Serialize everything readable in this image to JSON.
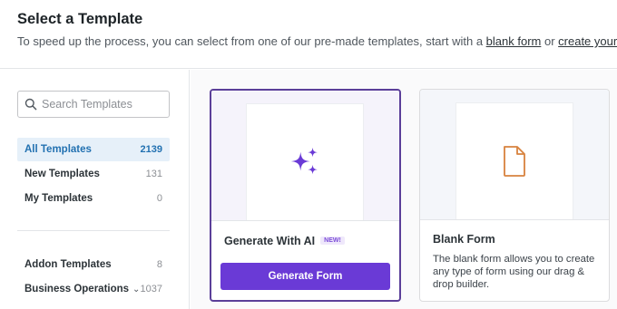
{
  "header": {
    "title": "Select a Template",
    "subtitle_pre": "To speed up the process, you can select from one of our pre-made templates, start with a ",
    "blank_form_link": "blank form",
    "subtitle_mid": " or ",
    "create_own_link": "create your own",
    "subtitle_post": "."
  },
  "sidebar": {
    "search": {
      "placeholder": "Search Templates",
      "value": ""
    },
    "groups": [
      {
        "label": "All Templates",
        "count": "2139",
        "active": true
      },
      {
        "label": "New Templates",
        "count": "131"
      },
      {
        "label": "My Templates",
        "count": "0"
      }
    ],
    "groups2": [
      {
        "label": "Addon Templates",
        "count": "8"
      },
      {
        "label": "Business Operations",
        "count": "1037"
      }
    ]
  },
  "cards": [
    {
      "name": "Generate With AI",
      "badge": "NEW!",
      "button_label": "Generate Form",
      "icon": "sparkles-icon",
      "selected": true
    },
    {
      "name": "Blank Form",
      "description": "The blank form allows you to create any type of form using our drag & drop builder.",
      "icon": "document-icon"
    }
  ],
  "colors": {
    "accent_purple": "#6a3ad6",
    "selected_border": "#5b3f99",
    "active_blue": "#2271b1",
    "doc_icon_orange": "#d8823e"
  }
}
